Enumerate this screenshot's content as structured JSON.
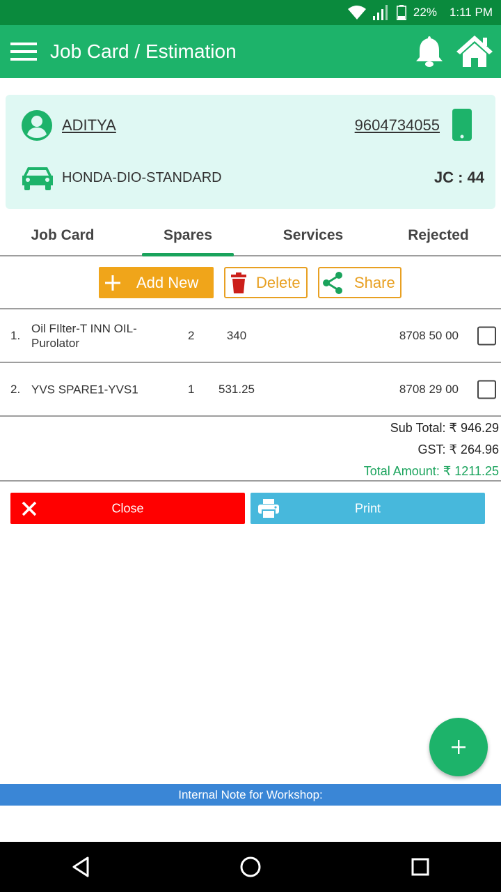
{
  "status_bar": {
    "battery": "22%",
    "time": "1:11 PM"
  },
  "app_bar": {
    "title": "Job Card / Estimation"
  },
  "customer": {
    "name": "ADITYA",
    "phone": "9604734055",
    "vehicle": "HONDA-DIO-STANDARD",
    "job_card": "JC : 44"
  },
  "tabs": [
    {
      "label": "Job Card",
      "active": false
    },
    {
      "label": "Spares",
      "active": true
    },
    {
      "label": "Services",
      "active": false
    },
    {
      "label": "Rejected",
      "active": false
    }
  ],
  "actions": {
    "add_label": "Add New",
    "delete_label": "Delete",
    "share_label": "Share"
  },
  "items": [
    {
      "index": "1.",
      "name": "Oil FIlter-T INN OIL-Purolator",
      "qty": "2",
      "price": "340",
      "hsn": "8708 50 00"
    },
    {
      "index": "2.",
      "name": "YVS SPARE1-YVS1",
      "qty": "1",
      "price": "531.25",
      "hsn": "8708 29 00"
    }
  ],
  "totals": {
    "subtotal": "Sub Total: ₹ 946.29",
    "gst": "GST: ₹ 264.96",
    "total": "Total Amount: ₹ 1211.25"
  },
  "buttons": {
    "close_label": "Close",
    "print_label": "Print"
  },
  "note": {
    "label": "Internal Note for Workshop:"
  },
  "colors": {
    "primary": "#1db36a",
    "status": "#0a8a3d",
    "accent": "#f0a51a",
    "danger": "#ff0000",
    "info": "#47b8dc",
    "note": "#3a86d6"
  }
}
